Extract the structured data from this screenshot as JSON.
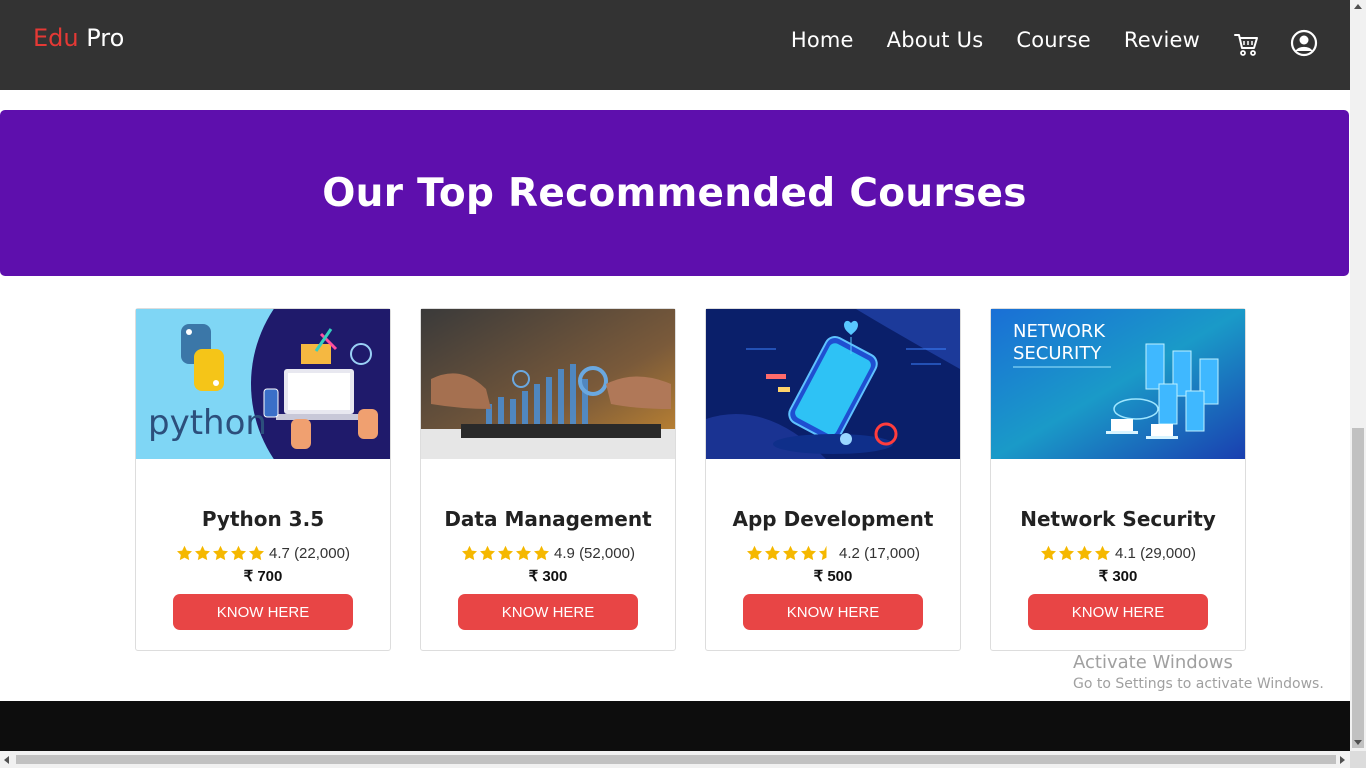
{
  "header": {
    "logo_part1": "Edu",
    "logo_part2": "Pro",
    "nav": [
      "Home",
      "About Us",
      "Course",
      "Review"
    ],
    "cart_icon": "cart-icon",
    "user_icon": "user-circle-icon",
    "bg_color": "#333333",
    "accent": "#e53935"
  },
  "banner": {
    "title": "Our Top Recommended Courses",
    "bg_color": "#5e0fad"
  },
  "courses": [
    {
      "title": "Python 3.5",
      "rating": 4.7,
      "rating_text": "4.7 (22,000)",
      "price": "₹ 700",
      "button": "KNOW HERE",
      "image_text": "python"
    },
    {
      "title": "Data Management",
      "rating": 4.9,
      "rating_text": "4.9 (52,000)",
      "price": "₹ 300",
      "button": "KNOW HERE",
      "image_text": ""
    },
    {
      "title": "App Development",
      "rating": 4.2,
      "rating_text": "4.2 (17,000)",
      "price": "₹ 500",
      "button": "KNOW HERE",
      "image_text": ""
    },
    {
      "title": "Network Security",
      "rating": 4.1,
      "rating_text": "4.1 (29,000)",
      "price": "₹ 300",
      "button": "KNOW HERE",
      "image_text": "NETWORK SECURITY"
    }
  ],
  "button_color": "#e84545",
  "star_color": "#f5b800",
  "watermark": {
    "line1": "Activate Windows",
    "line2": "Go to Settings to activate Windows."
  }
}
